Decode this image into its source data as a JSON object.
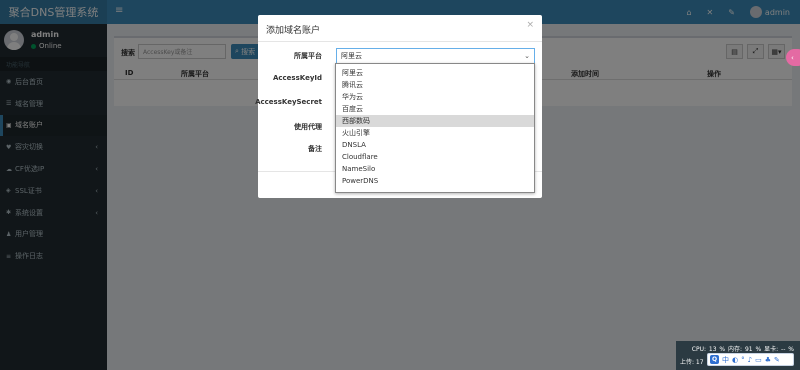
{
  "app": {
    "title": "聚合DNS管理系统"
  },
  "user": {
    "name": "admin",
    "status": "Online"
  },
  "sidebar": {
    "header": "功能导航",
    "items": [
      {
        "label": "后台首页",
        "icon": "dashboard-icon",
        "glyph": "◉",
        "chevron": false
      },
      {
        "label": "域名管理",
        "icon": "list-icon",
        "glyph": "☰",
        "chevron": false
      },
      {
        "label": "域名账户",
        "icon": "lock-icon",
        "glyph": "▣",
        "chevron": false,
        "active": true
      },
      {
        "label": "容灾切换",
        "icon": "heartbeat-icon",
        "glyph": "♥",
        "chevron": true
      },
      {
        "label": "CF优选IP",
        "icon": "cloud-icon",
        "glyph": "☁",
        "chevron": true
      },
      {
        "label": "SSL证书",
        "icon": "certificate-icon",
        "glyph": "◈",
        "chevron": true
      },
      {
        "label": "系统设置",
        "icon": "gear-icon",
        "glyph": "✱",
        "chevron": true
      },
      {
        "label": "用户管理",
        "icon": "user-icon",
        "glyph": "♟",
        "chevron": false
      },
      {
        "label": "操作日志",
        "icon": "log-icon",
        "glyph": "≡",
        "chevron": false
      }
    ]
  },
  "navbar": {
    "username": "admin"
  },
  "content": {
    "search_label": "搜索",
    "search_placeholder": "AccessKey或备注",
    "search_button": "搜索",
    "columns": [
      "ID",
      "所属平台",
      "添加时间",
      "操作"
    ]
  },
  "modal": {
    "title": "添加域名账户",
    "close": "×",
    "fields": {
      "platform_label": "所属平台",
      "platform_value": "阿里云",
      "accesskeyid_label": "AccessKeyId",
      "accesskeysecret_label": "AccessKeySecret",
      "proxy_label": "使用代理",
      "remark_label": "备注"
    }
  },
  "dropdown": {
    "options": [
      "阿里云",
      "腾讯云",
      "华为云",
      "百度云",
      "西部数码",
      "火山引擎",
      "DNSLA",
      "Cloudflare",
      "NameSilo",
      "PowerDNS"
    ],
    "highlighted_index": 4
  },
  "sysmon": {
    "line1": "CPU: 13 %   内存: 91 %   显卡: -- %",
    "line2": "上传: 17"
  },
  "ime": {
    "logo": "Q",
    "mode": "中"
  },
  "colors": {
    "navbar": "#3c8dbc",
    "sidebar": "#222d32",
    "logo": "#367fa9",
    "accent_pink": "#e46aa3"
  }
}
